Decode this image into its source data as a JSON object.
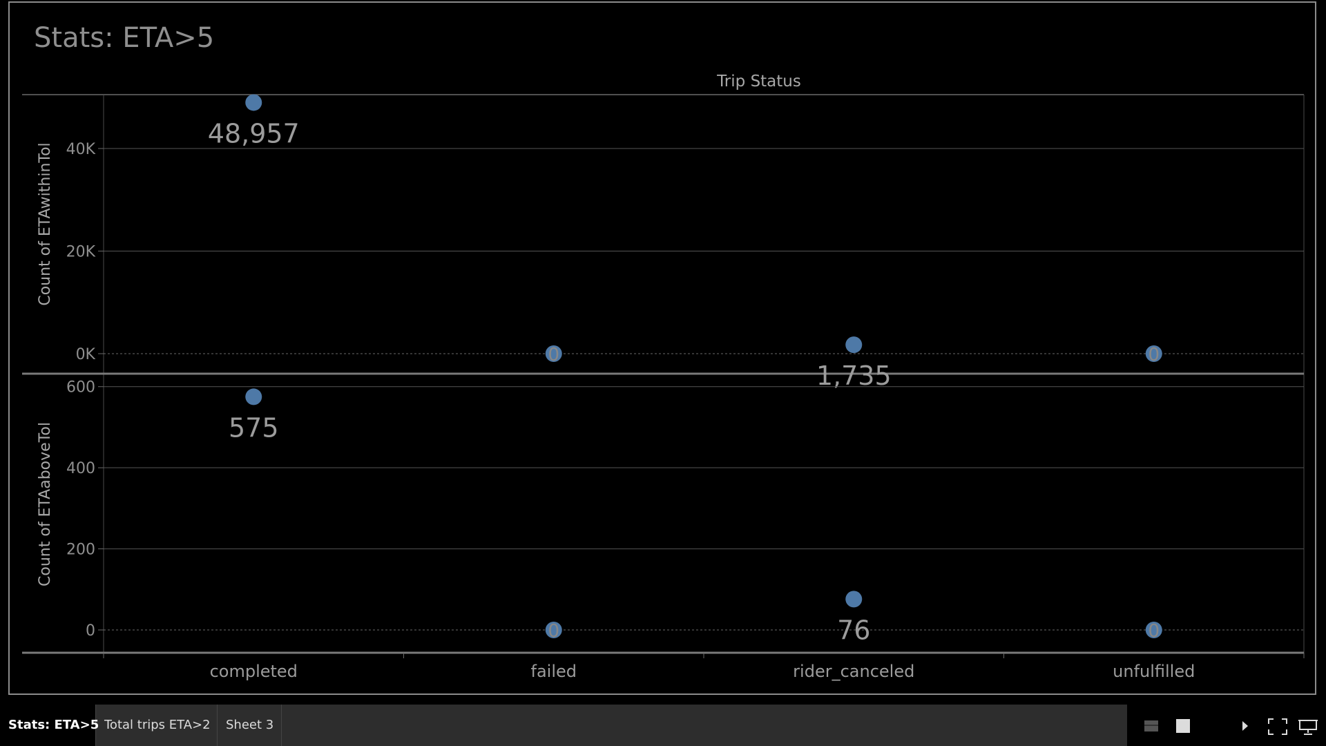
{
  "sheet_title": "Stats: ETA>5",
  "tabs": [
    {
      "label": "Stats: ETA>5",
      "active": true
    },
    {
      "label": "Total trips ETA>2",
      "active": false
    },
    {
      "label": "Sheet 3",
      "active": false
    }
  ],
  "toolbar_icons": [
    "grid-view-icon",
    "single-view-icon",
    "play-icon",
    "fullscreen-icon",
    "present-icon"
  ],
  "colors": {
    "mark": "#4e79a7",
    "background": "#000000",
    "tabbar": "#2d2d2d"
  },
  "chart_data": {
    "type": "scatter",
    "column_header": "Trip Status",
    "categories": [
      "completed",
      "failed",
      "rider_canceled",
      "unfulfilled"
    ],
    "panels": [
      {
        "ylabel": "Count of ETAwithinTol",
        "ylim": [
          0,
          50500
        ],
        "ticks": [
          0,
          20000,
          40000
        ],
        "tick_labels": [
          "0K",
          "20K",
          "40K"
        ],
        "values": [
          48957,
          0,
          1735,
          0
        ],
        "labels": [
          "48,957",
          "0",
          "1,735",
          "0"
        ]
      },
      {
        "ylabel": "Count of ETAaboveTol",
        "ylim": [
          0,
          620
        ],
        "ticks": [
          0,
          200,
          400,
          600
        ],
        "tick_labels": [
          "0",
          "200",
          "400",
          "600"
        ],
        "values": [
          575,
          0,
          76,
          0
        ],
        "labels": [
          "575",
          "0",
          "76",
          "0"
        ]
      }
    ],
    "grid": true
  }
}
